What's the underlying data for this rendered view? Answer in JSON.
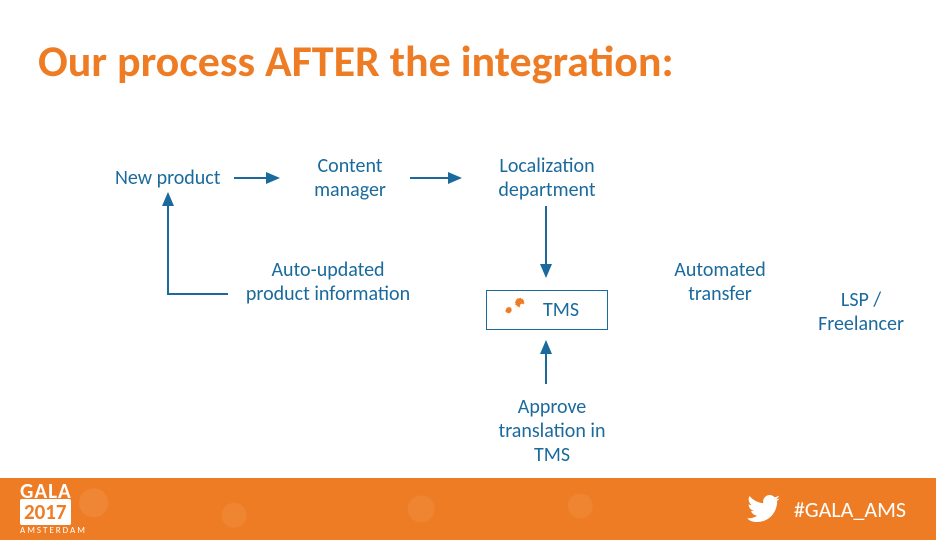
{
  "title": "Our process AFTER the integration:",
  "nodes": {
    "new_product": "New product",
    "content_manager_l1": "Content",
    "content_manager_l2": "manager",
    "localization_l1": "Localization",
    "localization_l2": "department",
    "auto_updated_l1": "Auto-updated",
    "auto_updated_l2": "product information",
    "tms": "TMS",
    "automated_l1": "Automated",
    "automated_l2": "transfer",
    "lsp_l1": "LSP /",
    "lsp_l2": "Freelancer",
    "approve_l1": "Approve",
    "approve_l2": "translation in",
    "approve_l3": "TMS"
  },
  "footer": {
    "gala": "GALA",
    "year": "2017",
    "city": "AMSTERDAM",
    "hashtag": "#GALA_AMS"
  },
  "colors": {
    "accent": "#ee7c24",
    "text": "#1a6a9d"
  }
}
